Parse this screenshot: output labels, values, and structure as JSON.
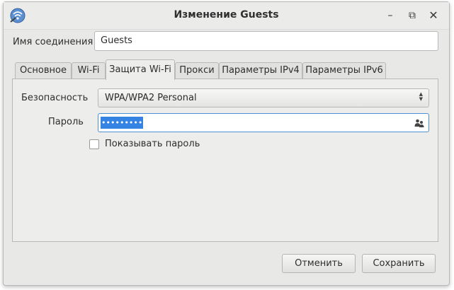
{
  "window": {
    "title": "Изменение Guests"
  },
  "connection": {
    "name_label": "Имя соединения",
    "name_value": "Guests"
  },
  "tabs": [
    {
      "label": "Основное"
    },
    {
      "label": "Wi-Fi"
    },
    {
      "label": "Защита Wi-Fi",
      "active": true
    },
    {
      "label": "Прокси"
    },
    {
      "label": "Параметры IPv4"
    },
    {
      "label": "Параметры IPv6"
    }
  ],
  "security": {
    "label": "Безопасность",
    "selected": "WPA/WPA2 Personal",
    "password_label": "Пароль",
    "password_value": "•••••••••",
    "show_password_label": "Показывать пароль"
  },
  "buttons": {
    "cancel": "Отменить",
    "save": "Сохранить"
  },
  "icons": {
    "app": "network-wireless-icon",
    "minimize": "minimize-icon",
    "maximize": "maximize-icon",
    "close": "close-icon",
    "password_users": "users-icon"
  },
  "colors": {
    "selection": "#3584e4",
    "focus_border": "#4a90d9"
  }
}
